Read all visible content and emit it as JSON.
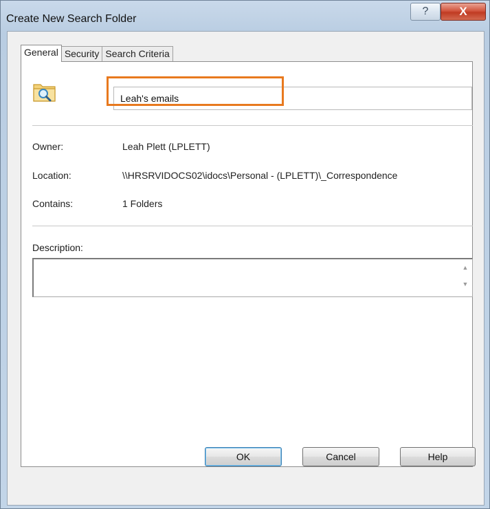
{
  "window": {
    "title": "Create New Search Folder",
    "help_icon": "?",
    "close_icon": "X"
  },
  "tabs": [
    {
      "label": "General",
      "active": true
    },
    {
      "label": "Security",
      "active": false
    },
    {
      "label": "Search Criteria",
      "active": false
    }
  ],
  "general": {
    "icon": "search-folder-icon",
    "name_value": "Leah's emails",
    "owner_label": "Owner:",
    "owner_value": "Leah Plett (LPLETT)",
    "location_label": "Location:",
    "location_value": "\\\\HRSRVIDOCS02\\idocs\\Personal - (LPLETT)\\_Correspondence",
    "contains_label": "Contains:",
    "contains_value": "1 Folders",
    "description_label": "Description:",
    "description_value": ""
  },
  "buttons": {
    "ok": "OK",
    "cancel": "Cancel",
    "help": "Help"
  },
  "colors": {
    "highlight": "#e8791e",
    "close_button": "#c03b23"
  }
}
